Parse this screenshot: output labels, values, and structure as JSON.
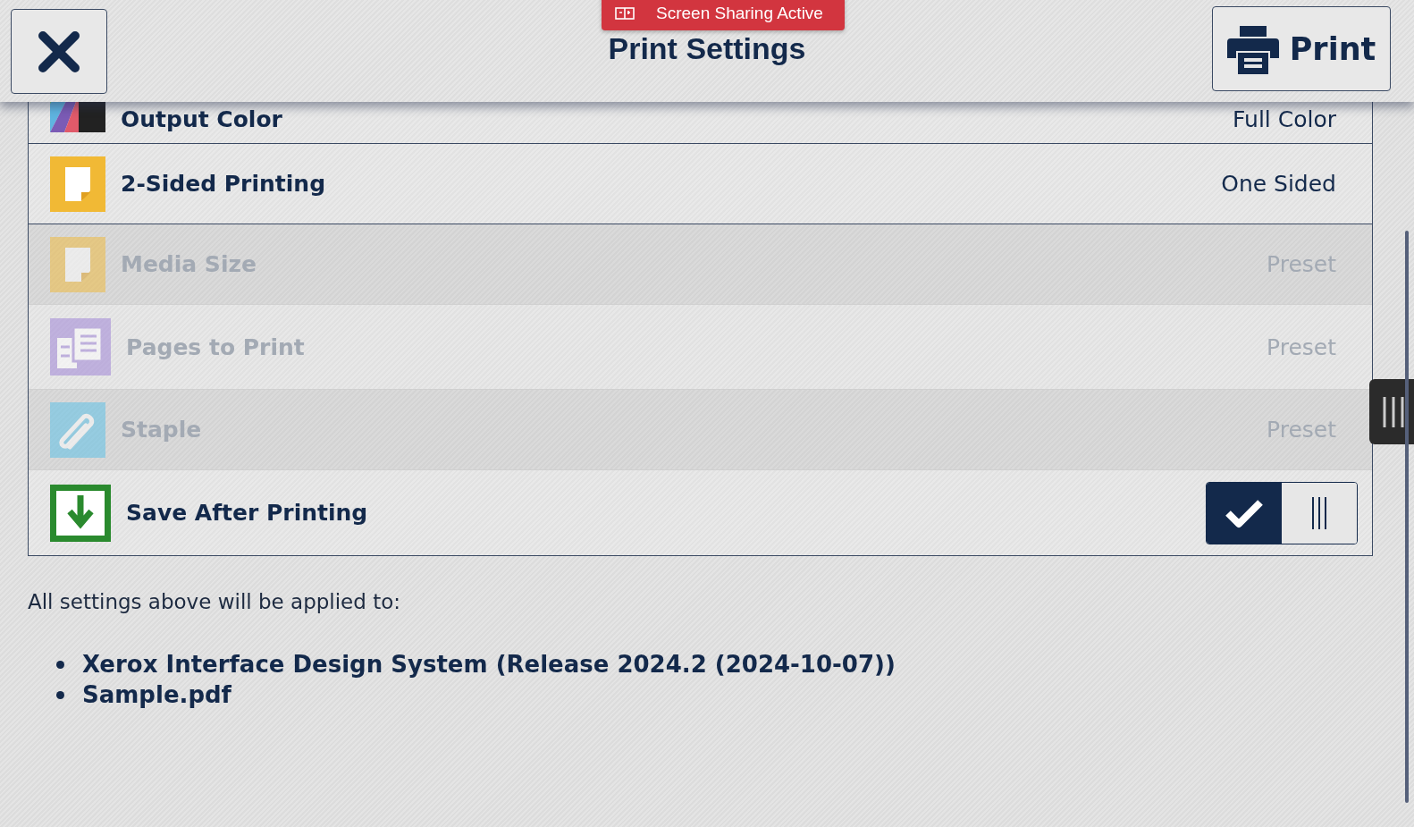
{
  "header": {
    "title": "Print Settings",
    "print_button": "Print",
    "sharing_badge": "Screen Sharing Active"
  },
  "settings": [
    {
      "kind": "value",
      "label": "Output Color",
      "value": "Full Color",
      "disabled": false
    },
    {
      "kind": "value",
      "label": "2-Sided Printing",
      "value": "One Sided",
      "disabled": false
    },
    {
      "kind": "value",
      "label": "Media Size",
      "value": "Preset",
      "disabled": true
    },
    {
      "kind": "value",
      "label": "Pages to Print",
      "value": "Preset",
      "disabled": true
    },
    {
      "kind": "value",
      "label": "Staple",
      "value": "Preset",
      "disabled": true
    },
    {
      "kind": "toggle",
      "label": "Save After Printing",
      "on": true,
      "disabled": false
    }
  ],
  "applied_note": "All settings above will be applied to:",
  "documents": [
    "Xerox Interface Design System (Release 2024.2 (2024-10-07))",
    "Sample.pdf"
  ]
}
